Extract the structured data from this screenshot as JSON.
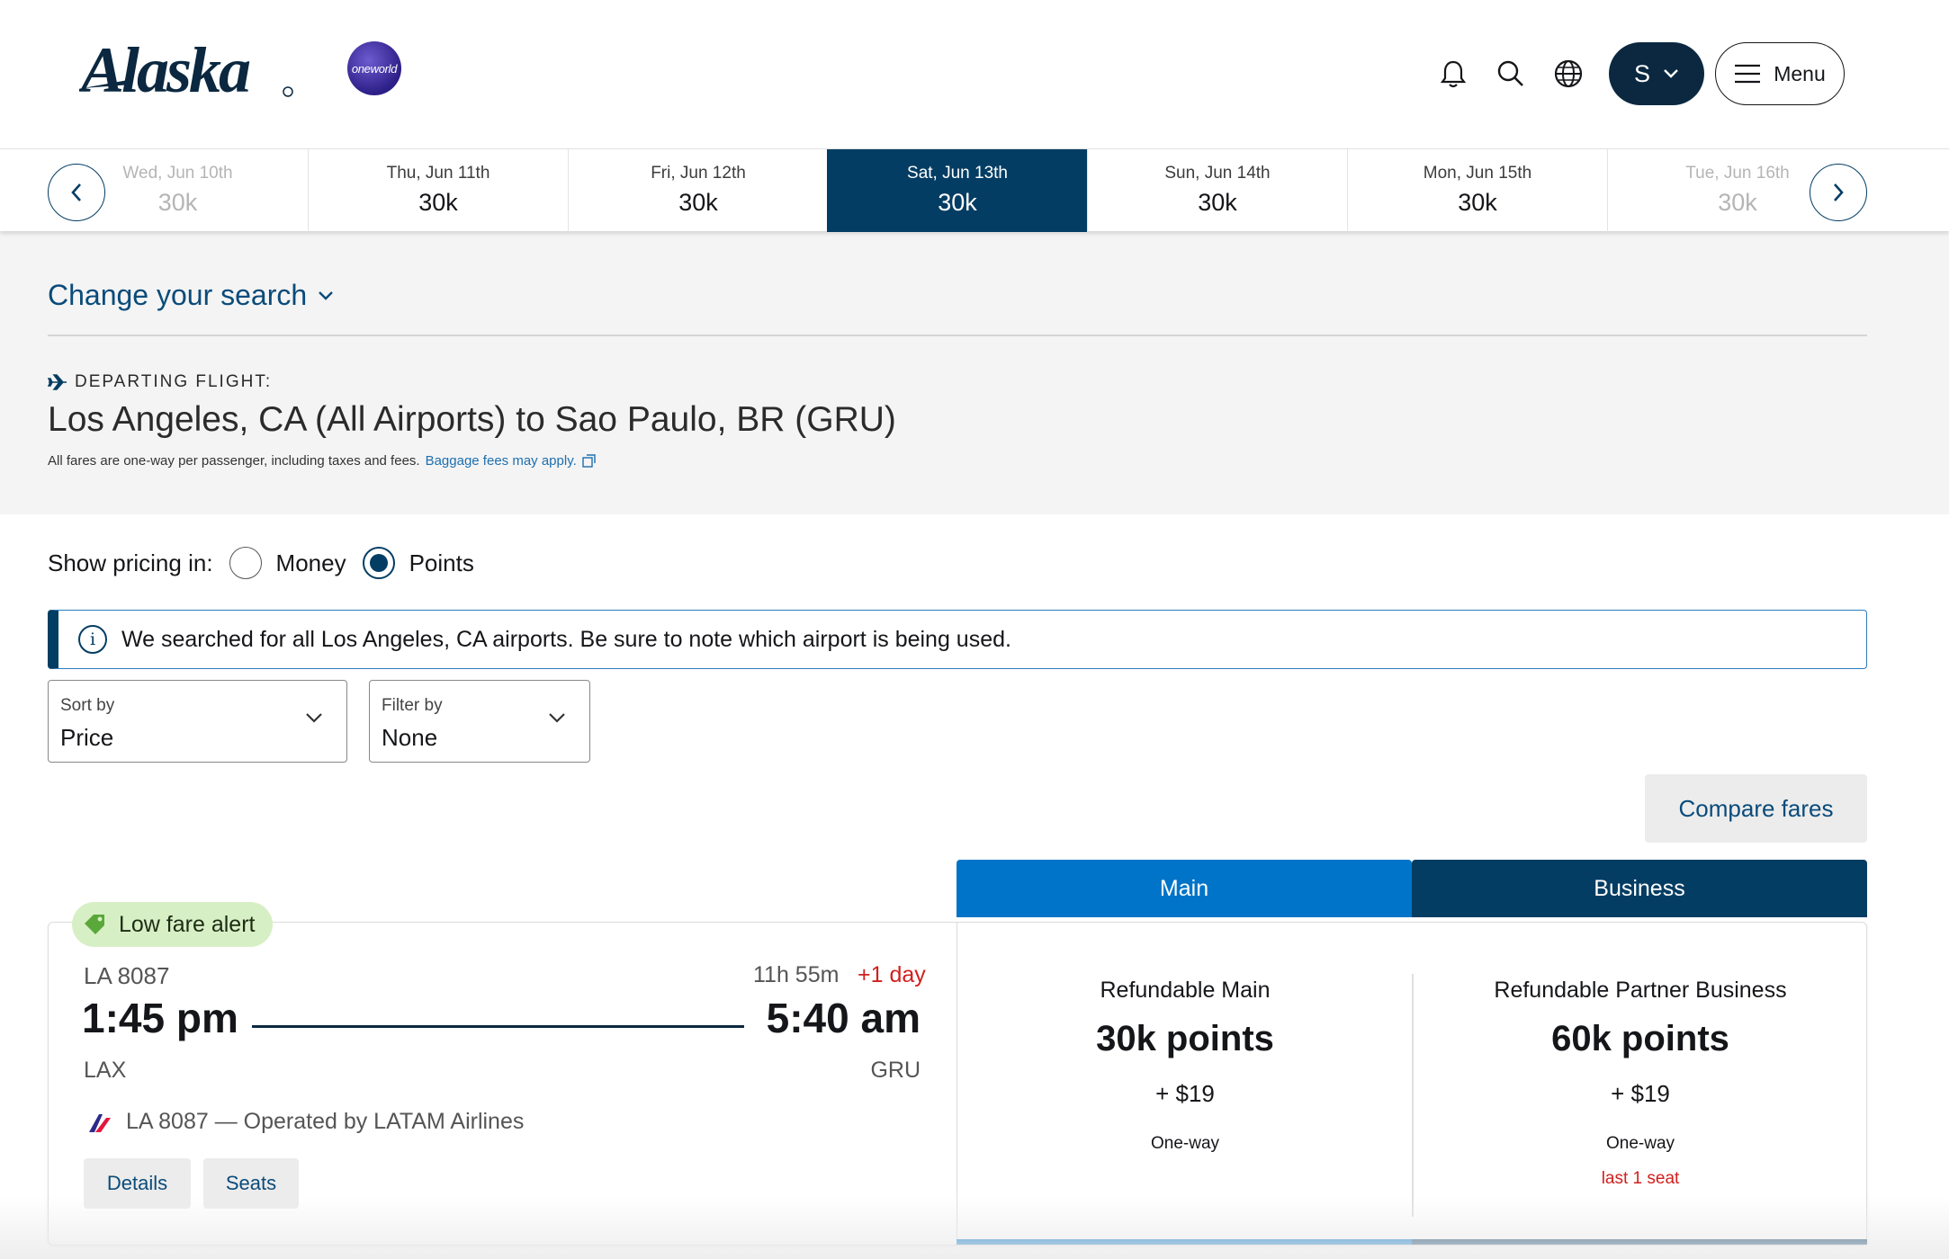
{
  "header": {
    "logo_text": "Alaska",
    "alliance_text": "oneworld",
    "user_initial": "S",
    "menu_label": "Menu"
  },
  "dates": [
    {
      "day": "Wed, Jun 10th",
      "price": "30k",
      "state": "faded"
    },
    {
      "day": "Thu, Jun 11th",
      "price": "30k",
      "state": "normal"
    },
    {
      "day": "Fri, Jun 12th",
      "price": "30k",
      "state": "normal"
    },
    {
      "day": "Sat, Jun 13th",
      "price": "30k",
      "state": "active"
    },
    {
      "day": "Sun, Jun 14th",
      "price": "30k",
      "state": "normal"
    },
    {
      "day": "Mon, Jun 15th",
      "price": "30k",
      "state": "normal"
    },
    {
      "day": "Tue, Jun 16th",
      "price": "30k",
      "state": "faded"
    }
  ],
  "search": {
    "change_label": "Change your search",
    "departing_label": "DEPARTING FLIGHT:",
    "route": "Los Angeles, CA (All Airports) to Sao Paulo, BR (GRU)",
    "fare_note": "All fares are one-way per passenger, including taxes and fees.",
    "baggage_link": "Baggage fees may apply."
  },
  "pricing": {
    "label": "Show pricing in:",
    "options": [
      "Money",
      "Points"
    ],
    "selected": "Points"
  },
  "info_banner": "We searched for all Los Angeles, CA airports. Be sure to note which airport is being used.",
  "sort": {
    "label": "Sort by",
    "value": "Price"
  },
  "filter": {
    "label": "Filter by",
    "value": "None"
  },
  "compare_label": "Compare fares",
  "fare_tabs": {
    "main": "Main",
    "business": "Business"
  },
  "flight": {
    "badge": "Low fare alert",
    "number": "LA 8087",
    "duration": "11h 55m",
    "day_offset": "+1 day",
    "depart_time": "1:45 pm",
    "arrive_time": "5:40 am",
    "depart_airport": "LAX",
    "arrive_airport": "GRU",
    "operated_by": "LA 8087 — Operated by LATAM Airlines",
    "details_label": "Details",
    "seats_label": "Seats"
  },
  "fares": [
    {
      "name": "Refundable Main",
      "points": "30k points",
      "tax": "+ $19",
      "trip": "One-way",
      "seats": ""
    },
    {
      "name": "Refundable Partner Business",
      "points": "60k points",
      "tax": "+ $19",
      "trip": "One-way",
      "seats": "last 1 seat"
    }
  ],
  "colors": {
    "navy": "#043d63",
    "main_blue": "#0074c8",
    "link_blue": "#0a4b7a",
    "alert_red": "#d0201d",
    "low_fare_green": "#d7efc5"
  }
}
